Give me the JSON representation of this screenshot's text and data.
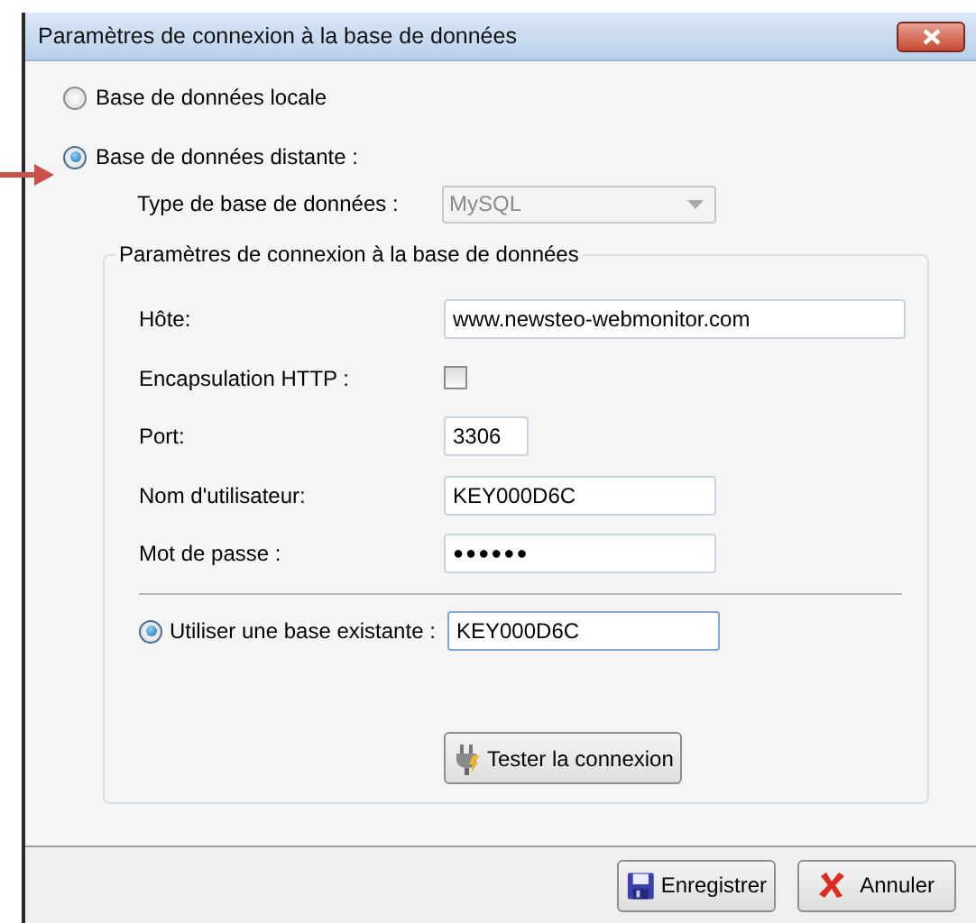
{
  "window": {
    "title": "Paramètres de connexion à la base de données"
  },
  "source_options": [
    {
      "label": "Base de données locale",
      "selected": false
    },
    {
      "label": "Base de données distante :",
      "selected": true
    }
  ],
  "database_type": {
    "label": "Type de base de données :",
    "value": "MySQL",
    "disabled": true
  },
  "connection_group": {
    "title": "Paramètres de connexion à la base de données",
    "fields": [
      {
        "kind": "text",
        "label": "Hôte:",
        "value": "www.newsteo-webmonitor.com"
      },
      {
        "kind": "checkbox",
        "label": "Encapsulation HTTP :",
        "checked": false
      },
      {
        "kind": "text",
        "label": "Port:",
        "value": "3306"
      },
      {
        "kind": "text",
        "label": "Nom d'utilisateur:",
        "value": "KEY000D6C"
      },
      {
        "kind": "password",
        "label": "Mot de passe :",
        "value": "●●●●●●"
      }
    ],
    "existing_base": {
      "label": "Utiliser une base existante :",
      "selected": true,
      "value": "KEY000D6C"
    },
    "test_button": {
      "label": "Tester la connexion"
    }
  },
  "buttons": [
    {
      "kind": "save",
      "label": "Enregistrer"
    },
    {
      "kind": "cancel",
      "label": "Annuler"
    }
  ]
}
